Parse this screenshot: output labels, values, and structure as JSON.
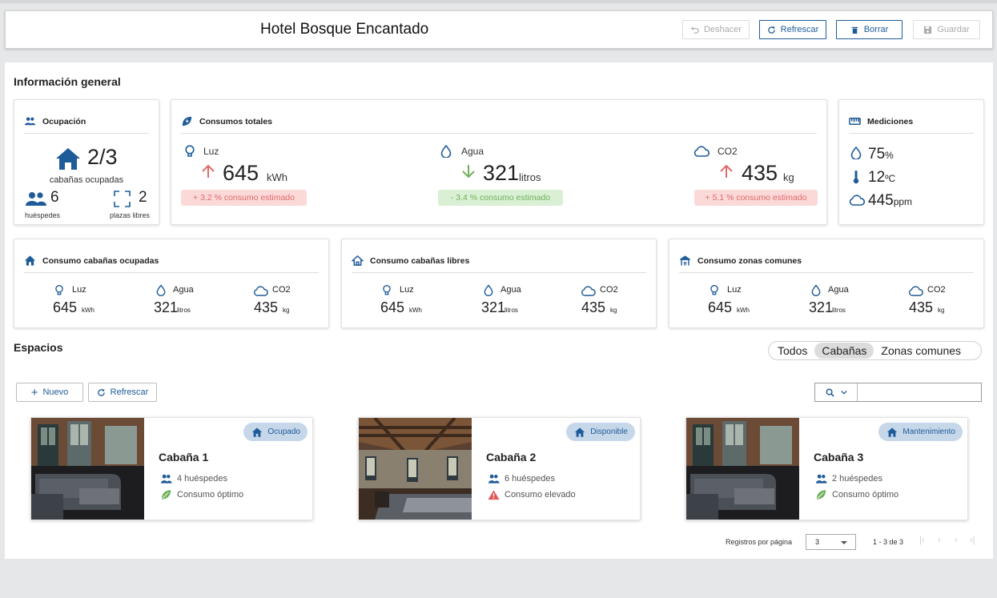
{
  "header": {
    "title": "Hotel Bosque Encantado",
    "buttons": {
      "undo": "Deshacer",
      "refresh": "Refrescar",
      "delete": "Borrar",
      "save": "Guardar"
    }
  },
  "general": {
    "title": "Información general",
    "occupancy": {
      "title": "Ocupación",
      "value": "2/3",
      "caption": "cabañas ocupadas",
      "guests_value": "6",
      "guests_label": "huéspedes",
      "free_value": "2",
      "free_label": "plazas libres"
    },
    "totals": {
      "title": "Consumos totales",
      "items": [
        {
          "label": "Luz",
          "value": "645",
          "unit": "kWh",
          "trend": "up",
          "note": "+ 3.2 % consumo estimado",
          "status": "red"
        },
        {
          "label": "Agua",
          "value": "321",
          "unit": "litros",
          "trend": "down",
          "note": "- 3.4 % consumo estimado",
          "status": "green"
        },
        {
          "label": "CO2",
          "value": "435",
          "unit": "kg",
          "trend": "up",
          "note": "+ 5.1 % consumo estimado",
          "status": "red"
        }
      ]
    },
    "measurements": {
      "title": "Mediciones",
      "humidity": "75",
      "humidity_unit": "%",
      "temperature": "12",
      "temperature_unit": "ºC",
      "co2": "445",
      "co2_unit": "ppm"
    },
    "groups": [
      {
        "title": "Consumo cabañas ocupadas",
        "icon": "house-icon",
        "items": [
          {
            "label": "Luz",
            "value": "645",
            "unit": "kWh"
          },
          {
            "label": "Agua",
            "value": "321",
            "unit": "litros"
          },
          {
            "label": "CO2",
            "value": "435",
            "unit": "kg"
          }
        ]
      },
      {
        "title": "Consumo cabañas libres",
        "icon": "house-outline-icon",
        "items": [
          {
            "label": "Luz",
            "value": "645",
            "unit": "kWh"
          },
          {
            "label": "Agua",
            "value": "321",
            "unit": "litros"
          },
          {
            "label": "CO2",
            "value": "435",
            "unit": "kg"
          }
        ]
      },
      {
        "title": "Consumo zonas comunes",
        "icon": "gazebo-icon",
        "items": [
          {
            "label": "Luz",
            "value": "645",
            "unit": "kWh"
          },
          {
            "label": "Agua",
            "value": "321",
            "unit": "litros"
          },
          {
            "label": "CO2",
            "value": "435",
            "unit": "kg"
          }
        ]
      }
    ]
  },
  "spaces": {
    "title": "Espacios",
    "filters": [
      "Todos",
      "Cabañas",
      "Zonas comunes"
    ],
    "selected_filter": "Cabañas",
    "new_button": "Nuevo",
    "refresh_button": "Refrescar",
    "search_value": "",
    "cards": [
      {
        "name": "Cabaña 1",
        "status": "Ocupado",
        "guests": "4 huéspedes",
        "consumption": "Consumo óptimo",
        "consumption_state": "ok"
      },
      {
        "name": "Cabaña 2",
        "status": "Disponible",
        "guests": "6 huéspedes",
        "consumption": "Consumo elevado",
        "consumption_state": "warning"
      },
      {
        "name": "Cabaña 3",
        "status": "Mantenimiento",
        "guests": "2 huéspedes",
        "consumption": "Consumo óptimo",
        "consumption_state": "ok"
      }
    ]
  },
  "pagination": {
    "per_page_label": "Registros por página",
    "per_page": "3",
    "range": "1 - 3 de 3"
  },
  "colors": {
    "accent": "#1e5b99",
    "badge_bg": "#c6d7ea",
    "warn_red": "#e06a6a",
    "ok_green": "#6fb05c"
  }
}
